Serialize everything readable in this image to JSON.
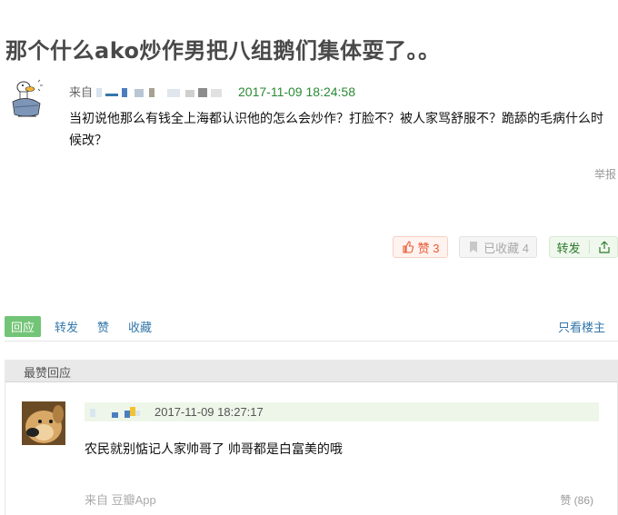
{
  "post": {
    "title": "那个什么ako炒作男把八组鹅们集体耍了。。",
    "from_label": "来自",
    "time": "2017-11-09 18:24:58",
    "content": "当初说他那么有钱全上海都认识他的怎么会炒作？打脸不？被人家骂舒服不？跪舔的毛病什么时候改？",
    "report": "举报"
  },
  "buttons": {
    "like": "赞 3",
    "favorite": "已收藏 4",
    "share": "转发"
  },
  "actions": {
    "reply": "回应",
    "repost": "转发",
    "like": "赞",
    "favorite": "收藏",
    "only_owner": "只看楼主"
  },
  "hot": {
    "header": "最赞回应"
  },
  "comment": {
    "time": "2017-11-09 18:27:17",
    "text": "农民就别惦记人家帅哥了 帅哥都是白富美的哦",
    "from": "来自 豆瓣App",
    "votes": "赞 (86)"
  },
  "colors": {
    "link": "#3377aa",
    "time_green": "#2b8a34",
    "reply_tab": "#72c476",
    "like": "#e85a35"
  },
  "icons": {
    "like": "thumb-up-icon",
    "favorite": "bookmark-icon",
    "share": "share-icon"
  }
}
